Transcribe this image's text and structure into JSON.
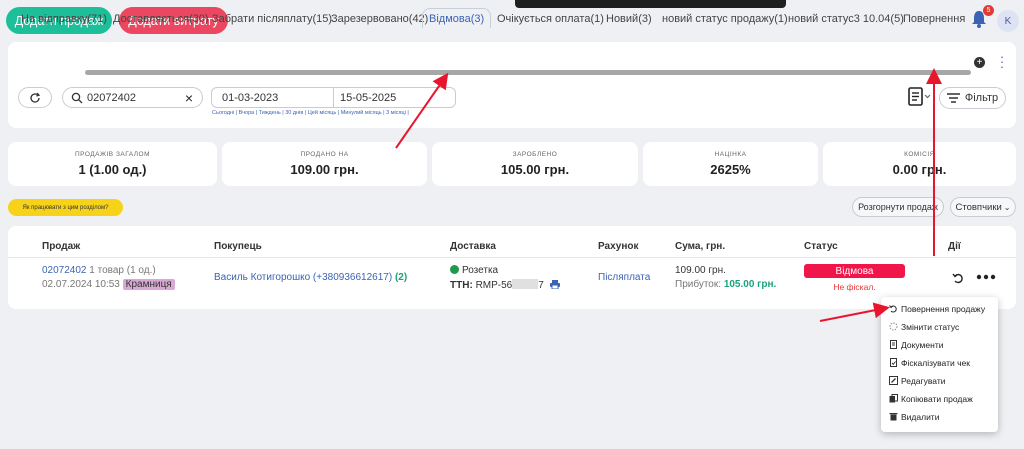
{
  "header": {
    "add_sale": "Додати продаж",
    "add_expense": "Додати витрату",
    "notifications_count": "5",
    "user_initial": "K"
  },
  "tabs": [
    {
      "label": "На відправку(71)"
    },
    {
      "label": "Доставляється(30)"
    },
    {
      "label": "Забрати післяплату(15)"
    },
    {
      "label": "Зарезервовано(42)"
    },
    {
      "label": "Відмова(3)",
      "active": true
    },
    {
      "label": "Очікується оплата(1)"
    },
    {
      "label": "Новий(3)"
    },
    {
      "label": "новий статус продажу(1)"
    },
    {
      "label": "новий статус3 10.04(5)"
    },
    {
      "label": "Повернення"
    }
  ],
  "filters": {
    "search_value": "02072402",
    "date_from": "01-03-2023",
    "date_to": "15-05-2025",
    "quick_dates": "Сьогодні | Вчора | Тиждень | 30 днів | Цей місяць | Минулий місяць | 3 місяці |",
    "filter_label": "Фільтр"
  },
  "stats": [
    {
      "label": "ПРОДАЖІВ ЗАГАЛОМ",
      "value": "1 (1.00 од.)"
    },
    {
      "label": "ПРОДАНО НА",
      "value": "109.00 грн."
    },
    {
      "label": "ЗАРОБЛЕНО",
      "value": "105.00 грн."
    },
    {
      "label": "НАЦІНКА",
      "value": "2625%"
    },
    {
      "label": "КОМІСІЯ",
      "value": "0.00 грн."
    }
  ],
  "toolbar": {
    "help": "Як працювати з цим розділом?",
    "expand": "Розгорнути продаж",
    "columns": "Стовпчики"
  },
  "table": {
    "headers": {
      "sale": "Продаж",
      "buyer": "Покупець",
      "delivery": "Доставка",
      "account": "Рахунок",
      "amount": "Сума, грн.",
      "status": "Статус",
      "actions": "Дії"
    },
    "row": {
      "sale_id": "02072402",
      "items": "1 товар (1 од.)",
      "datetime": "02.07.2024 10:53",
      "shop": "Крамниця",
      "buyer": "Василь Котигорошко (+380936612617)",
      "buyer_count": "(2)",
      "delivery_method": "Розетка",
      "ttn_label": "ТТН:",
      "ttn_prefix": "RMP-56",
      "ttn_suffix": "7",
      "account": "Післяплата",
      "amount": "109.00 грн.",
      "profit_label": "Прибуток:",
      "profit_value": "105.00 грн.",
      "status": "Відмова",
      "fiscal": "Не фіскал."
    }
  },
  "menu": [
    {
      "label": "Повернення продажу",
      "icon": "undo-icon"
    },
    {
      "label": "Змінити статус",
      "icon": "status-icon"
    },
    {
      "label": "Документи",
      "icon": "document-icon"
    },
    {
      "label": "Фіскалізувати чек",
      "icon": "receipt-icon"
    },
    {
      "label": "Редагувати",
      "icon": "edit-icon"
    },
    {
      "label": "Копіювати продаж",
      "icon": "copy-icon"
    },
    {
      "label": "Видалити",
      "icon": "trash-icon"
    }
  ],
  "colors": {
    "accent": "#3b63b5",
    "sale_green": "#1dbf9a",
    "expense_red": "#ec4760",
    "status_red": "#f0164a",
    "annotation_red": "#e8162c"
  }
}
